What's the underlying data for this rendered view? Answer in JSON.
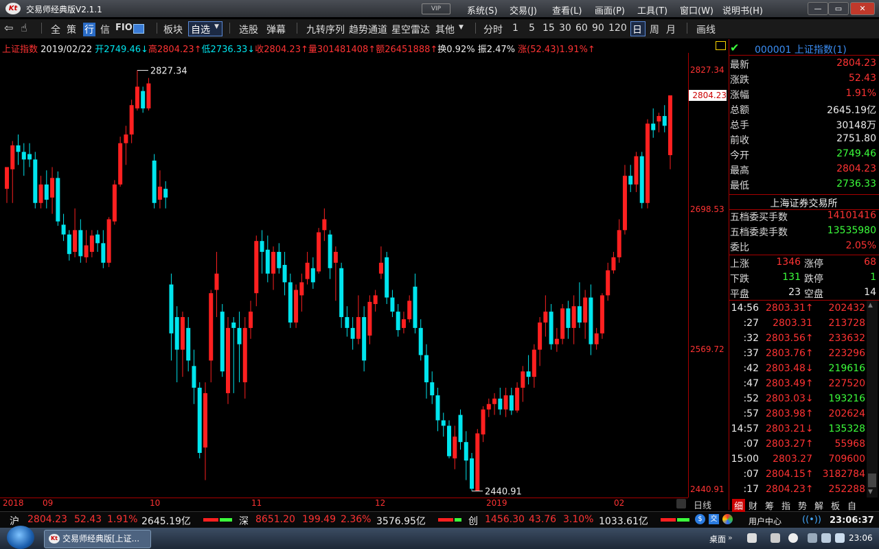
{
  "window": {
    "title": "交易师经典版V2.1.1",
    "vip_badge": "VIP",
    "menus": [
      "系统(S)",
      "交易(J)",
      "查看(L)",
      "画面(P)",
      "工具(T)",
      "窗口(W)",
      "说明书(H)"
    ],
    "controls": [
      "—",
      "▭",
      "✕"
    ]
  },
  "toolbar": {
    "items": [
      "全",
      "策",
      "行",
      "信",
      "FIO"
    ],
    "bankuai": "板块",
    "zixuan": "自选",
    "group2": [
      "选股",
      "弹幕"
    ],
    "group3": [
      "九转序列",
      "趋势通道",
      "星空雷达",
      "其他"
    ],
    "periods": [
      "分时",
      "1",
      "5",
      "15",
      "30",
      "60",
      "90",
      "120",
      "日",
      "周",
      "月"
    ],
    "draw": "画线"
  },
  "infoline": {
    "name": "上证指数",
    "date": "2019/02/22",
    "open": "开2749.46↓",
    "high": "高2804.23↑",
    "low": "低2736.33↓",
    "close": "收2804.23↑",
    "volume": "量301481408↑",
    "amount": "额26451888↑",
    "turnover": "换0.92%",
    "amplitude": "振2.47%",
    "change": "涨(52.43)1.91%↑"
  },
  "chart_data": {
    "type": "candlestick",
    "title": "上证指数 日线",
    "y_ticks": [
      "2827.34",
      "2698.53",
      "2569.72",
      "2440.91"
    ],
    "ylim": [
      2440.91,
      2827.34
    ],
    "x_labels": [
      "2018",
      "09",
      "10",
      "11",
      "12",
      "2019",
      "02"
    ],
    "high_marker": "2827.34",
    "low_marker": "2440.91",
    "last_price": "2804.23",
    "up_color": "#ff2020",
    "down_color": "#00e5ee",
    "candles": [
      [
        2718,
        2738,
        2738,
        2705
      ],
      [
        2736,
        2758,
        2762,
        2705
      ],
      [
        2758,
        2752,
        2768,
        2740
      ],
      [
        2752,
        2745,
        2760,
        2730
      ],
      [
        2750,
        2745,
        2760,
        2738
      ],
      [
        2745,
        2705,
        2752,
        2700
      ],
      [
        2705,
        2722,
        2730,
        2700
      ],
      [
        2722,
        2708,
        2735,
        2700
      ],
      [
        2710,
        2728,
        2738,
        2695
      ],
      [
        2728,
        2688,
        2734,
        2684
      ],
      [
        2685,
        2676,
        2695,
        2670
      ],
      [
        2676,
        2658,
        2680,
        2652
      ],
      [
        2660,
        2680,
        2700,
        2655
      ],
      [
        2680,
        2656,
        2690,
        2650
      ],
      [
        2655,
        2666,
        2680,
        2650
      ],
      [
        2660,
        2675,
        2680,
        2655
      ],
      [
        2676,
        2668,
        2680,
        2660
      ],
      [
        2668,
        2650,
        2680,
        2645
      ],
      [
        2650,
        2690,
        2692,
        2646
      ],
      [
        2688,
        2722,
        2726,
        2685
      ],
      [
        2722,
        2760,
        2766,
        2720
      ],
      [
        2760,
        2768,
        2776,
        2740
      ],
      [
        2768,
        2795,
        2800,
        2760
      ],
      [
        2792,
        2812,
        2827,
        2790
      ],
      [
        2808,
        2792,
        2812,
        2788
      ],
      [
        2792,
        2815,
        2820,
        2790
      ],
      [
        2744,
        2705,
        2750,
        2700
      ],
      [
        2708,
        2720,
        2735,
        2700
      ],
      [
        2718,
        2710,
        2725,
        2700
      ],
      [
        2630,
        2585,
        2640,
        2560
      ],
      [
        2600,
        2570,
        2610,
        2540
      ],
      [
        2570,
        2600,
        2605,
        2545
      ],
      [
        2590,
        2560,
        2600,
        2550
      ],
      [
        2555,
        2535,
        2570,
        2520
      ],
      [
        2535,
        2475,
        2540,
        2470
      ],
      [
        2480,
        2530,
        2540,
        2450
      ],
      [
        2560,
        2622,
        2625,
        2540
      ],
      [
        2625,
        2640,
        2660,
        2600
      ],
      [
        2605,
        2550,
        2612,
        2545
      ],
      [
        2530,
        2590,
        2600,
        2520
      ],
      [
        2595,
        2590,
        2600,
        2530
      ],
      [
        2590,
        2575,
        2605,
        2540
      ],
      [
        2540,
        2590,
        2600,
        2525
      ],
      [
        2590,
        2605,
        2615,
        2580
      ],
      [
        2622,
        2670,
        2675,
        2610
      ],
      [
        2670,
        2660,
        2680,
        2640
      ],
      [
        2662,
        2640,
        2675,
        2632
      ],
      [
        2640,
        2660,
        2665,
        2625
      ],
      [
        2660,
        2645,
        2668,
        2640
      ],
      [
        2648,
        2632,
        2660,
        2620
      ],
      [
        2632,
        2595,
        2640,
        2590
      ],
      [
        2595,
        2625,
        2630,
        2590
      ],
      [
        2620,
        2632,
        2640,
        2605
      ],
      [
        2635,
        2650,
        2660,
        2630
      ],
      [
        2645,
        2632,
        2655,
        2626
      ],
      [
        2642,
        2678,
        2682,
        2640
      ],
      [
        2680,
        2690,
        2700,
        2670
      ],
      [
        2676,
        2645,
        2680,
        2635
      ],
      [
        2650,
        2660,
        2665,
        2615
      ],
      [
        2645,
        2600,
        2650,
        2590
      ],
      [
        2600,
        2590,
        2610,
        2582
      ],
      [
        2590,
        2580,
        2600,
        2570
      ],
      [
        2580,
        2600,
        2620,
        2575
      ],
      [
        2600,
        2560,
        2610,
        2550
      ],
      [
        2583,
        2614,
        2620,
        2575
      ],
      [
        2612,
        2620,
        2625,
        2605
      ],
      [
        2640,
        2650,
        2665,
        2635
      ],
      [
        2655,
        2618,
        2660,
        2612
      ],
      [
        2618,
        2605,
        2625,
        2600
      ],
      [
        2605,
        2588,
        2612,
        2582
      ],
      [
        2590,
        2598,
        2605,
        2585
      ],
      [
        2598,
        2615,
        2620,
        2595
      ],
      [
        2628,
        2590,
        2640,
        2585
      ],
      [
        2590,
        2565,
        2598,
        2560
      ],
      [
        2565,
        2540,
        2575,
        2525
      ],
      [
        2540,
        2528,
        2550,
        2520
      ],
      [
        2528,
        2505,
        2535,
        2495
      ],
      [
        2505,
        2500,
        2512,
        2490
      ],
      [
        2500,
        2472,
        2505,
        2470
      ],
      [
        2470,
        2490,
        2500,
        2460
      ],
      [
        2510,
        2485,
        2515,
        2478
      ],
      [
        2485,
        2468,
        2495,
        2450
      ],
      [
        2470,
        2442,
        2475,
        2440
      ],
      [
        2440,
        2493,
        2497,
        2441
      ],
      [
        2492,
        2515,
        2518,
        2485
      ],
      [
        2515,
        2520,
        2525,
        2508
      ],
      [
        2520,
        2525,
        2530,
        2510
      ],
      [
        2525,
        2515,
        2535,
        2510
      ],
      [
        2515,
        2528,
        2535,
        2508
      ],
      [
        2528,
        2514,
        2535,
        2510
      ],
      [
        2514,
        2535,
        2540,
        2512
      ],
      [
        2535,
        2550,
        2555,
        2522
      ],
      [
        2550,
        2545,
        2565,
        2538
      ],
      [
        2545,
        2570,
        2575,
        2535
      ],
      [
        2570,
        2595,
        2600,
        2555
      ],
      [
        2595,
        2605,
        2620,
        2582
      ],
      [
        2605,
        2575,
        2612,
        2570
      ],
      [
        2575,
        2580,
        2590,
        2568
      ],
      [
        2580,
        2608,
        2612,
        2575
      ],
      [
        2608,
        2590,
        2615,
        2580
      ],
      [
        2590,
        2610,
        2620,
        2575
      ],
      [
        2610,
        2595,
        2632,
        2590
      ],
      [
        2595,
        2618,
        2625,
        2580
      ],
      [
        2618,
        2575,
        2630,
        2565
      ],
      [
        2575,
        2585,
        2590,
        2570
      ],
      [
        2585,
        2620,
        2622,
        2580
      ],
      [
        2620,
        2643,
        2650,
        2615
      ],
      [
        2643,
        2655,
        2660,
        2640
      ],
      [
        2655,
        2680,
        2690,
        2650
      ],
      [
        2680,
        2730,
        2740,
        2676
      ],
      [
        2730,
        2722,
        2740,
        2715
      ],
      [
        2722,
        2748,
        2752,
        2715
      ],
      [
        2748,
        2705,
        2752,
        2700
      ],
      [
        2705,
        2778,
        2782,
        2700
      ],
      [
        2778,
        2772,
        2792,
        2765
      ],
      [
        2780,
        2785,
        2788,
        2770
      ],
      [
        2785,
        2776,
        2795,
        2770
      ],
      [
        2749,
        2804,
        2804,
        2736
      ]
    ]
  },
  "right_panel": {
    "code_line": "000001 上证指数(1)",
    "quotes": [
      {
        "label": "最新",
        "value": "2804.23",
        "color": "red"
      },
      {
        "label": "涨跌",
        "value": "52.43",
        "color": "red"
      },
      {
        "label": "涨幅",
        "value": "1.91%",
        "color": "red"
      },
      {
        "label": "总额",
        "value": "2645.19亿",
        "color": "white"
      },
      {
        "label": "总手",
        "value": "30148万",
        "color": "white"
      },
      {
        "label": "前收",
        "value": "2751.80",
        "color": "white"
      },
      {
        "label": "今开",
        "value": "2749.46",
        "color": "green"
      },
      {
        "label": "最高",
        "value": "2804.23",
        "color": "red"
      },
      {
        "label": "最低",
        "value": "2736.33",
        "color": "green"
      }
    ],
    "exchange": "上海证券交易所",
    "orders": [
      {
        "label": "五档委买手数",
        "value": "14101416",
        "color": "red"
      },
      {
        "label": "五档委卖手数",
        "value": "13535980",
        "color": "green"
      },
      {
        "label": "委比",
        "value": "2.05%",
        "color": "red"
      }
    ],
    "breadth": [
      {
        "l1": "上涨",
        "v1": "1346",
        "c1": "red",
        "l2": "涨停",
        "v2": "68",
        "c2": "red"
      },
      {
        "l1": "下跌",
        "v1": "131",
        "c1": "green",
        "l2": "跌停",
        "v2": "1",
        "c2": "green"
      },
      {
        "l1": "平盘",
        "v1": "23",
        "c1": "white",
        "l2": "空盘",
        "v2": "14",
        "c2": "white"
      }
    ],
    "ticks": [
      {
        "time": "14:56",
        "price": "2803.31↑",
        "vol": "202432",
        "pc": "red",
        "vc": "red"
      },
      {
        "time": ":27",
        "price": "2803.31",
        "vol": "213728",
        "pc": "red",
        "vc": "red"
      },
      {
        "time": ":32",
        "price": "2803.56↑",
        "vol": "233632",
        "pc": "red",
        "vc": "red"
      },
      {
        "time": ":37",
        "price": "2803.76↑",
        "vol": "223296",
        "pc": "red",
        "vc": "red"
      },
      {
        "time": ":42",
        "price": "2803.48↓",
        "vol": "219616",
        "pc": "red",
        "vc": "green"
      },
      {
        "time": ":47",
        "price": "2803.49↑",
        "vol": "227520",
        "pc": "red",
        "vc": "red"
      },
      {
        "time": ":52",
        "price": "2803.03↓",
        "vol": "193216",
        "pc": "red",
        "vc": "green"
      },
      {
        "time": ":57",
        "price": "2803.98↑",
        "vol": "202624",
        "pc": "red",
        "vc": "red"
      },
      {
        "time": "14:57",
        "price": "2803.21↓",
        "vol": "135328",
        "pc": "red",
        "vc": "green"
      },
      {
        "time": ":07",
        "price": "2803.27↑",
        "vol": "55968",
        "pc": "red",
        "vc": "red"
      },
      {
        "time": "15:00",
        "price": "2803.27",
        "vol": "709600",
        "pc": "red",
        "vc": "red"
      },
      {
        "time": ":07",
        "price": "2804.15↑",
        "vol": "3182784",
        "pc": "red",
        "vc": "red"
      },
      {
        "time": ":17",
        "price": "2804.23↑",
        "vol": "252288",
        "pc": "red",
        "vc": "red"
      }
    ],
    "tabs": [
      "细",
      "财",
      "筹",
      "指",
      "势",
      "解",
      "板",
      "自"
    ]
  },
  "status": {
    "sh_label": "沪",
    "sh_price": "2804.23",
    "sh_chg": "52.43",
    "sh_pct": "1.91%",
    "sh_amt": "2645.19亿",
    "sz_label": "深",
    "sz_price": "8651.20",
    "sz_chg": "199.49",
    "sz_pct": "2.36%",
    "sz_amt": "3576.95亿",
    "cy_label": "创",
    "cy_price": "1456.30",
    "cy_chg": "43.76",
    "cy_pct": "3.10%",
    "cy_amt": "1033.61亿",
    "user_center": "用户中心",
    "time": "23:06:37"
  },
  "taskbar": {
    "task_label": "交易师经典版[上证...",
    "desktop": "桌面",
    "clock": "23:06"
  },
  "labels": {
    "rixian": "日线"
  }
}
